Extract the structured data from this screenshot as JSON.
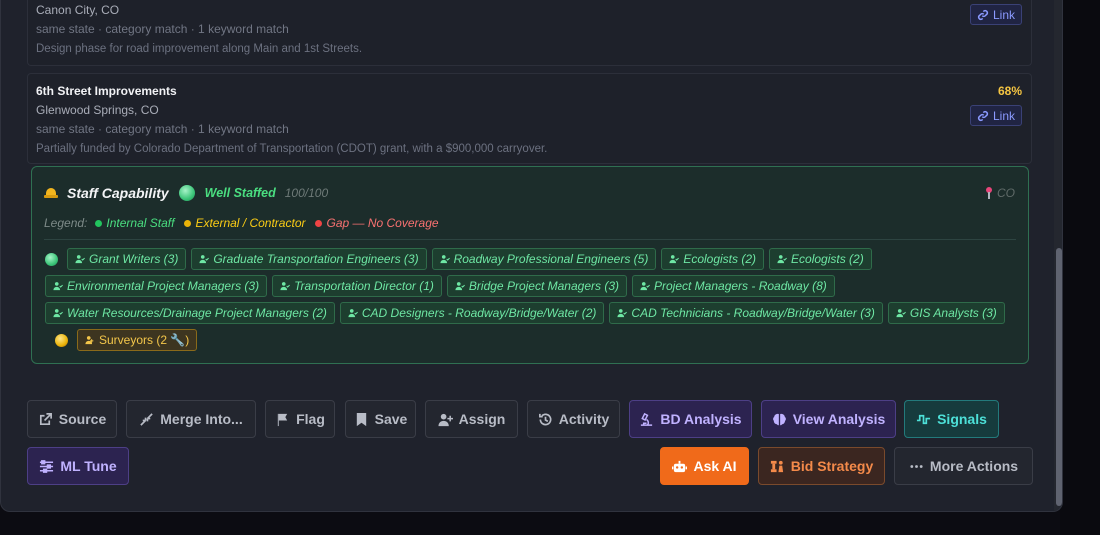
{
  "projects": [
    {
      "title": "",
      "location": "Canon City, CO",
      "match": "same state · category match · 1 keyword match",
      "description": "Design phase for road improvement along Main and 1st Streets.",
      "score": "",
      "link_label": "Link"
    },
    {
      "title": "6th Street Improvements",
      "location": "Glenwood Springs, CO",
      "match": "same state · category match · 1 keyword match",
      "description": "Partially funded by Colorado Department of Transportation (CDOT) grant, with a $900,000 carryover.",
      "score": "68%",
      "link_label": "Link"
    }
  ],
  "staff": {
    "title": "Staff Capability",
    "status": "Well Staffed",
    "score": "100/100",
    "region": "CO",
    "legend_label": "Legend:",
    "legend": [
      {
        "label": "Internal Staff",
        "color": "#22c55e"
      },
      {
        "label": "External / Contractor",
        "color": "#eab308"
      },
      {
        "label": "Gap — No Coverage",
        "color": "#ef4444"
      }
    ],
    "internal_roles": [
      "Grant Writers (3)",
      "Graduate Transportation Engineers (3)",
      "Roadway Professional Engineers (5)",
      "Ecologists (2)",
      "Ecologists (2)",
      "Environmental Project Managers (3)",
      "Transportation Director (1)",
      "Bridge Project Managers (3)",
      "Project Managers - Roadway (8)",
      "Water Resources/Drainage Project Managers (2)",
      "CAD Designers - Roadway/Bridge/Water (2)",
      "CAD Technicians - Roadway/Bridge/Water (3)",
      "GIS Analysts (3)"
    ],
    "external_roles": [
      "Surveyors (2 🔧)"
    ]
  },
  "actions": {
    "source": "Source",
    "merge": "Merge Into...",
    "flag": "Flag",
    "save": "Save",
    "assign": "Assign",
    "activity": "Activity",
    "bd_analysis": "BD Analysis",
    "view_analysis": "View Analysis",
    "signals": "Signals",
    "ml_tune": "ML Tune",
    "ask_ai": "Ask AI",
    "bid_strategy": "Bid Strategy",
    "more_actions": "More Actions"
  },
  "colors": {
    "score": "#f5c542",
    "internal": "#6ee7a4",
    "external": "#f3c64a",
    "accent_orange": "#f06a1a"
  }
}
